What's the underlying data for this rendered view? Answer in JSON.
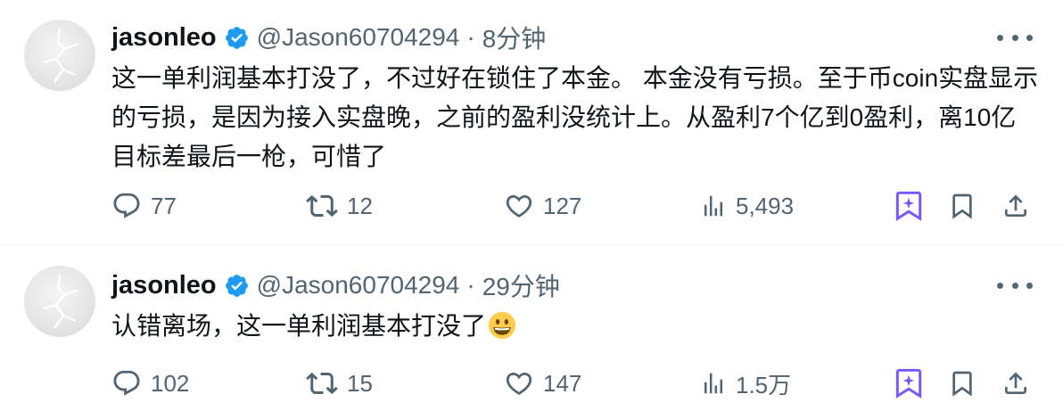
{
  "tweets": [
    {
      "author": {
        "name": "jasonleo",
        "handle": "@Jason60704294",
        "verified": true
      },
      "separator": "·",
      "time": "8分钟",
      "text": "这一单利润基本打没了，不过好在锁住了本金。 本金没有亏损。至于币coin实盘显示的亏损，是因为接入实盘晚，之前的盈利没统计上。从盈利7个亿到0盈利，离10亿目标差最后一枪，可惜了",
      "emoji": "",
      "stats": {
        "replies": "77",
        "retweets": "12",
        "likes": "127",
        "views": "5,493"
      }
    },
    {
      "author": {
        "name": "jasonleo",
        "handle": "@Jason60704294",
        "verified": true
      },
      "separator": "·",
      "time": "29分钟",
      "text": "认错离场，这一单利润基本打没了",
      "emoji": "grinning-face",
      "stats": {
        "replies": "102",
        "retweets": "15",
        "likes": "147",
        "views": "1.5万"
      }
    }
  ],
  "colors": {
    "text": "#0f1419",
    "secondary": "#536471",
    "verified": "#1d9bf0",
    "grok_accent": "#7856ff",
    "divider": "#eff3f4"
  },
  "icons": {
    "reply": "speech-bubble-icon",
    "retweet": "retweet-arrows-icon",
    "like": "heart-icon",
    "views": "bar-chart-icon",
    "grok": "grok-bookmark-sparkle-icon",
    "bookmark": "bookmark-icon",
    "share": "share-upload-icon",
    "more": "more-dots-icon",
    "verified": "verified-badge-icon"
  }
}
